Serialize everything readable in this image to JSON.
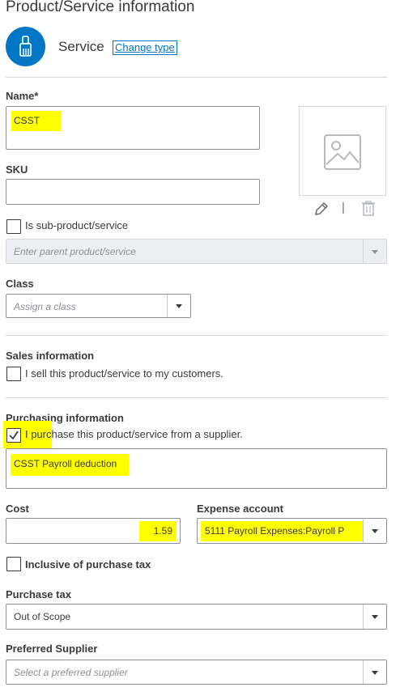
{
  "header": {
    "title": "Product/Service information",
    "type_label": "Service",
    "change_type": "Change type",
    "type_icon": "paint-brush-icon"
  },
  "name": {
    "label": "Name*",
    "value": "CSST"
  },
  "image": {
    "icon": "image-placeholder-icon",
    "edit_icon": "pencil-icon",
    "delete_icon": "trash-icon",
    "separator": "|"
  },
  "sku": {
    "label": "SKU",
    "value": ""
  },
  "sub_product": {
    "label": "Is sub-product/service",
    "checked": false,
    "parent_placeholder": "Enter parent product/service"
  },
  "class_field": {
    "label": "Class",
    "placeholder": "Assign a class"
  },
  "sales": {
    "heading": "Sales information",
    "checkbox_label": "I sell this product/service to my customers.",
    "checked": false
  },
  "purchasing": {
    "heading": "Purchasing information",
    "checkbox_label": "I purchase this product/service from a supplier.",
    "checked": true,
    "description": "CSST Payroll deduction"
  },
  "cost": {
    "label": "Cost",
    "value": "1.59"
  },
  "expense_account": {
    "label": "Expense account",
    "value": "5111 Payroll Expenses:Payroll P"
  },
  "inclusive_tax": {
    "label": "Inclusive of purchase tax",
    "checked": false
  },
  "purchase_tax": {
    "label": "Purchase tax",
    "value": "Out of Scope"
  },
  "preferred_supplier": {
    "label": "Preferred Supplier",
    "placeholder": "Select a preferred supplier"
  },
  "colors": {
    "brand_blue": "#0077c5",
    "highlight": "#ffff00",
    "border": "#8d9096",
    "divider": "#d4d7dc"
  }
}
